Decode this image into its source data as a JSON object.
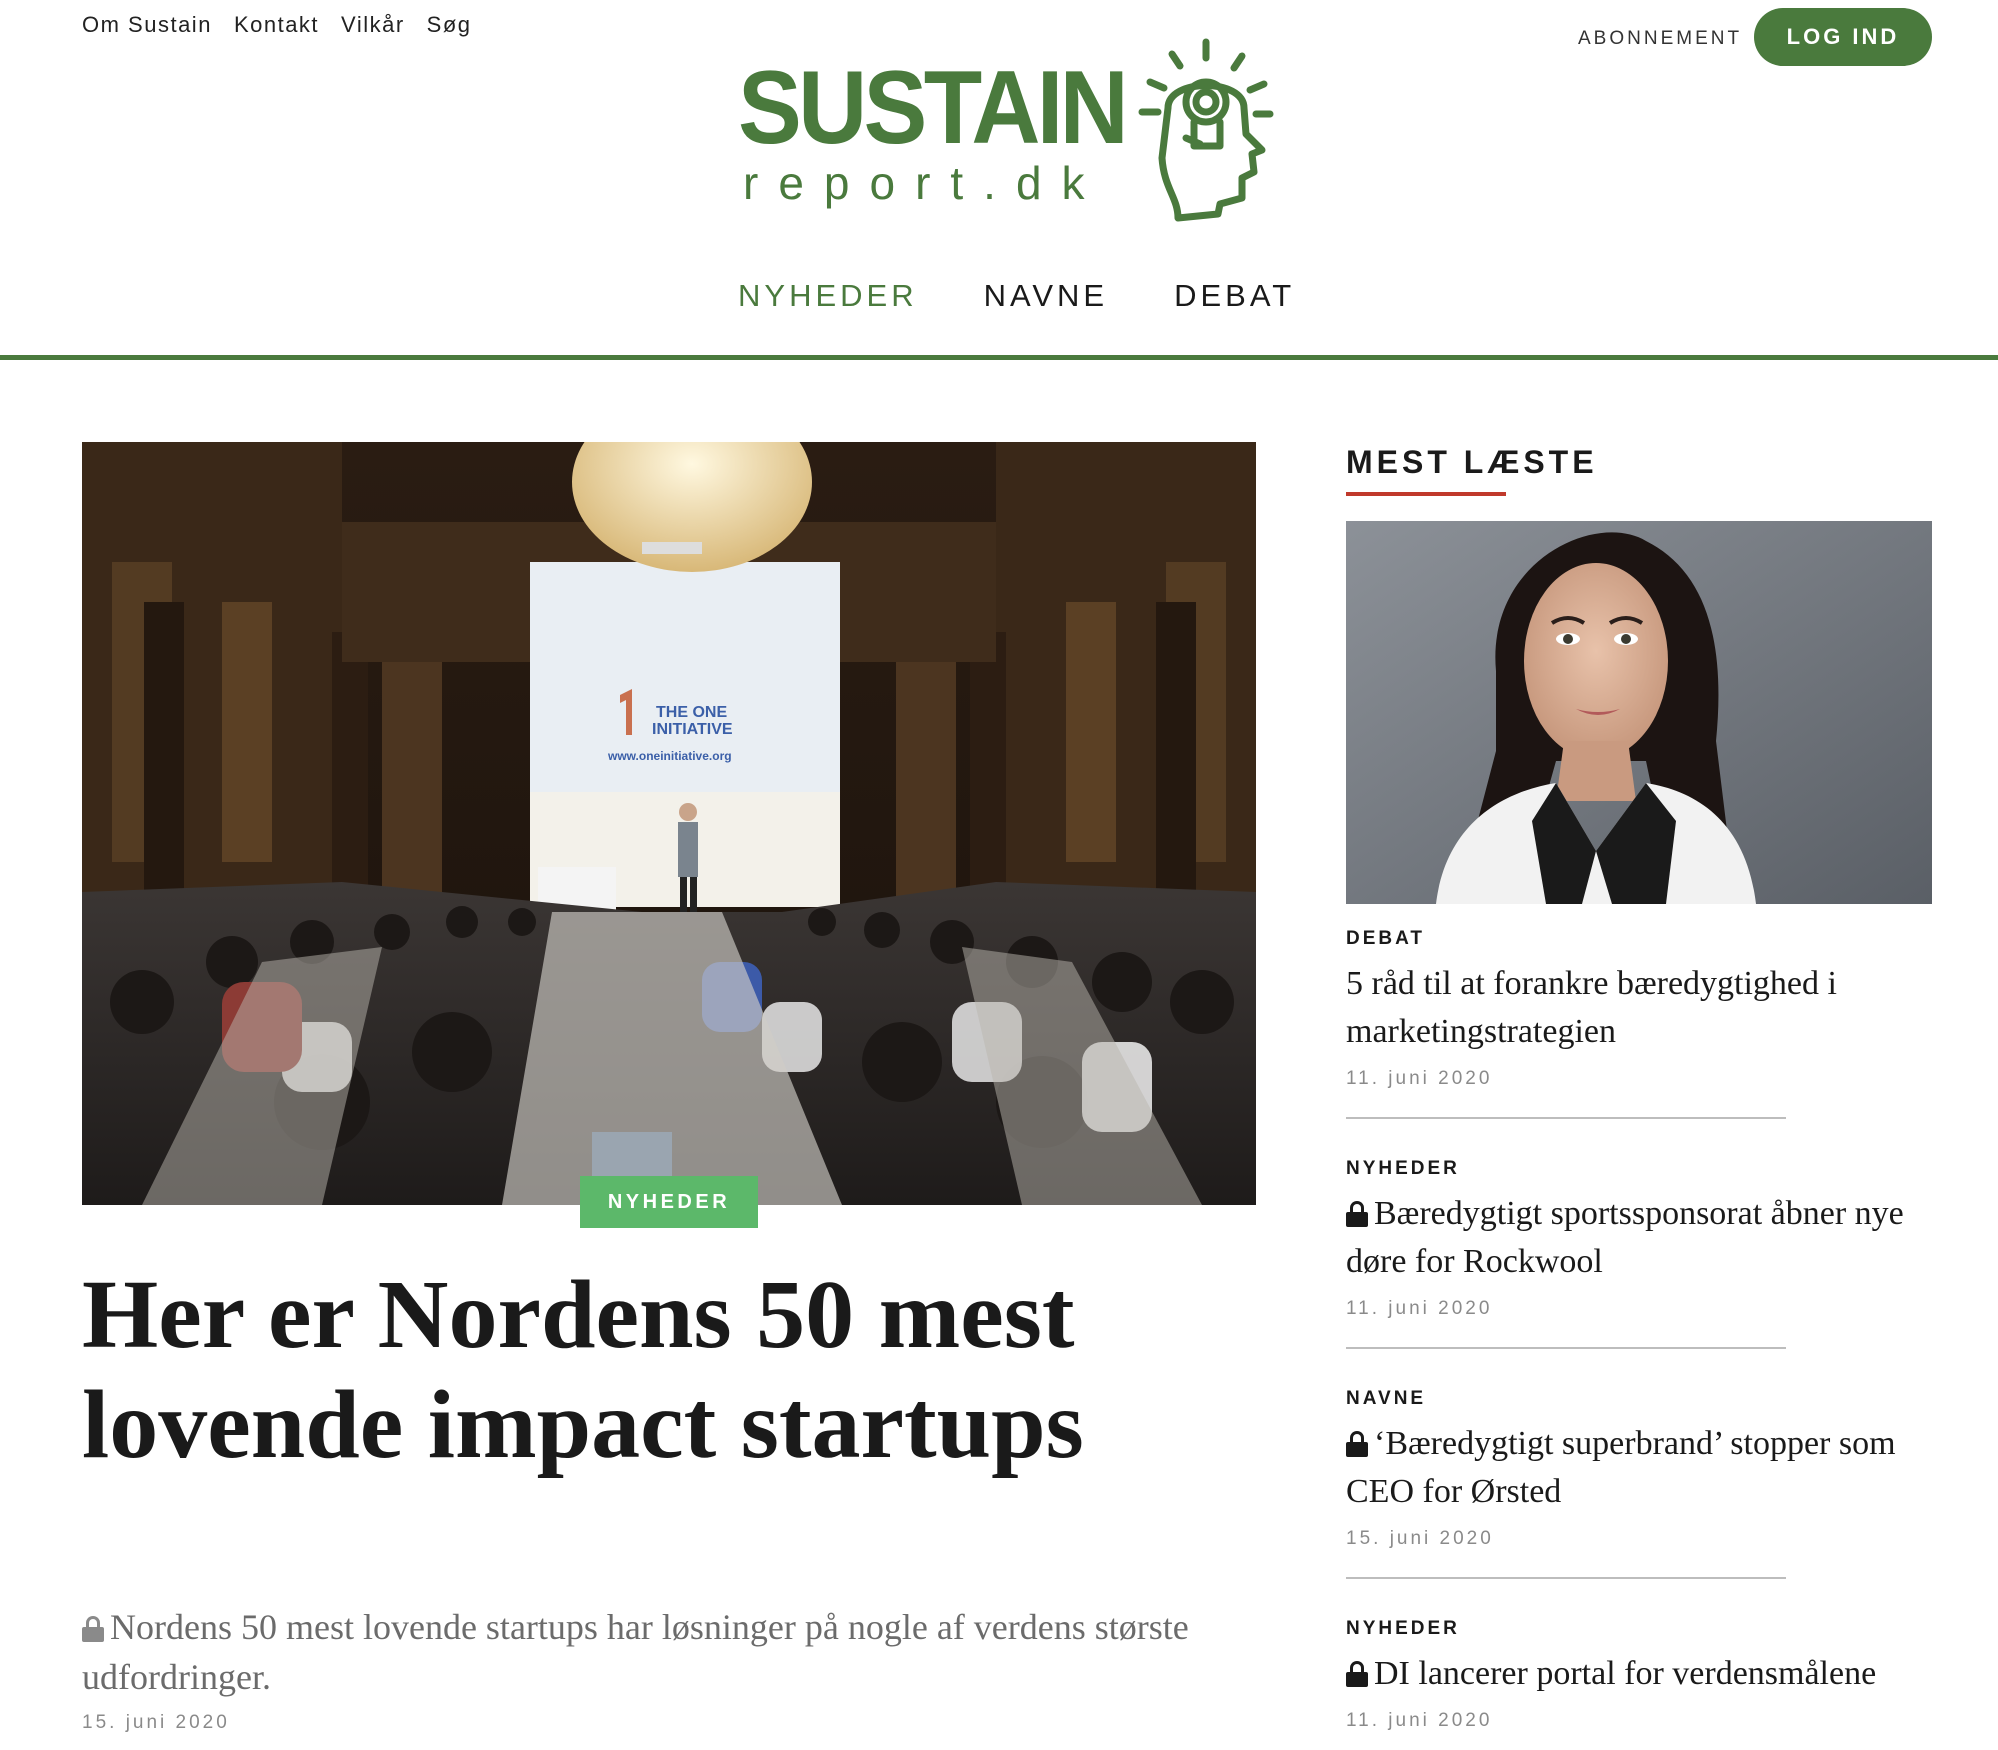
{
  "top_links": [
    "Om Sustain",
    "Kontakt",
    "Vilkår",
    "Søg"
  ],
  "header": {
    "subscribe_label": "ABONNEMENT",
    "login_label": "LOG IND",
    "logo_main": "SUSTAIN",
    "logo_sub": "report.dk"
  },
  "nav": {
    "items": [
      "NYHEDER",
      "NAVNE",
      "DEBAT"
    ],
    "active": "NYHEDER"
  },
  "hero": {
    "tag": "NYHEDER",
    "title": "Her er Nordens 50 mest lovende impact startups",
    "lead": "Nordens 50 mest lovende startups har løsninger på nogle af verdens største udfordringer.",
    "date": "15. juni 2020",
    "locked": true,
    "image_screen_text": {
      "line1": "THE ONE",
      "line2": "INITIATIVE",
      "url": "www.oneinitiative.org"
    }
  },
  "sidebar": {
    "heading": "MEST LÆSTE",
    "items": [
      {
        "category": "DEBAT",
        "title": "5 råd til at forankre bæredygtighed i marketingstrategien",
        "date": "11. juni 2020",
        "locked": false
      },
      {
        "category": "NYHEDER",
        "title": "Bæredygtigt sportssponsorat åbner nye døre for Rockwool",
        "date": "11. juni 2020",
        "locked": true
      },
      {
        "category": "NAVNE",
        "title": "‘Bæredygtigt superbrand’ stopper som CEO for Ørsted",
        "date": "15. juni 2020",
        "locked": true
      },
      {
        "category": "NYHEDER",
        "title": "DI lancerer portal for verdensmålene",
        "date": "11. juni 2020",
        "locked": true
      }
    ]
  },
  "colors": {
    "brand_green": "#4a7a3d",
    "tag_green": "#5cb86a",
    "accent_red": "#c0392b"
  }
}
